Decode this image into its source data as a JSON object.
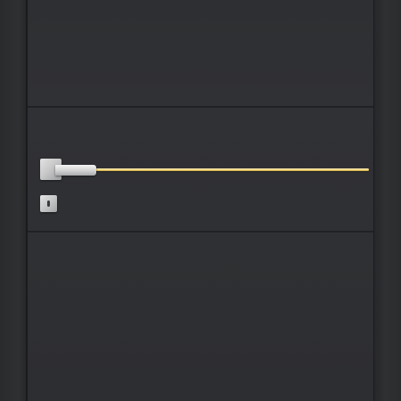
{
  "scene": {
    "subject": "",
    "colors": {
      "door_surface": "#2f3033",
      "frame": "#2a2b2d",
      "groove": "#1c1d1f",
      "gold_inlay": "#f1d67a",
      "brushed_steel": "#c9c9ca",
      "keyhole": "#3a3a3c"
    },
    "icons": [
      "door-handle-icon",
      "keyhole-icon"
    ]
  }
}
